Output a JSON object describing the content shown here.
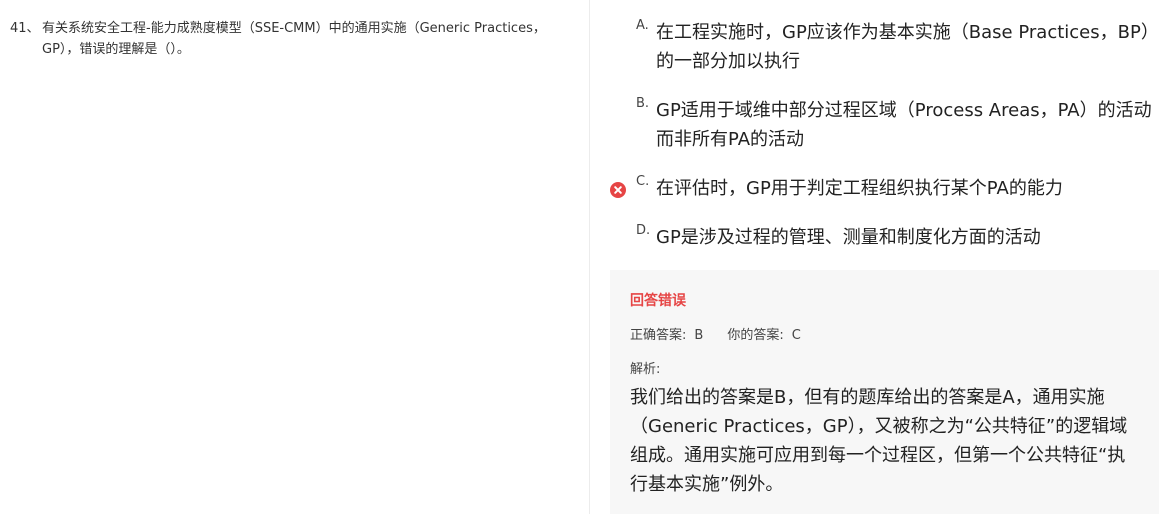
{
  "question": {
    "number": "41、",
    "text": "有关系统安全工程-能力成熟度模型（SSE-CMM）中的通用实施（Generic Practices，GP），错误的理解是（）。"
  },
  "options": [
    {
      "letter": "A.",
      "text": "在工程实施时，GP应该作为基本实施（Base Practices，BP）的一部分加以执行",
      "state": "none"
    },
    {
      "letter": "B.",
      "text": "GP适用于域维中部分过程区域（Process Areas，PA）的活动而非所有PA的活动",
      "state": "none"
    },
    {
      "letter": "C.",
      "text": "在评估时，GP用于判定工程组织执行某个PA的能力",
      "state": "selected-wrong"
    },
    {
      "letter": "D.",
      "text": "GP是涉及过程的管理、测量和制度化方面的活动",
      "state": "none"
    }
  ],
  "result": {
    "title": "回答错误",
    "correct_label": "正确答案:",
    "correct_value": "B",
    "yours_label": "你的答案:",
    "yours_value": "C",
    "analysis_label": "解析:",
    "analysis_text": "我们给出的答案是B，但有的题库给出的答案是A，通用实施（Generic Practices，GP），又被称之为“公共特征”的逻辑域组成。通用实施可应用到每一个过程区，但第一个公共特征“执行基本实施”例外。"
  },
  "colors": {
    "error_red": "#e64545",
    "panel_bg": "#f7f7f7",
    "divider": "#ececec"
  },
  "icons": {
    "wrong_marker": "close-circle-icon"
  }
}
